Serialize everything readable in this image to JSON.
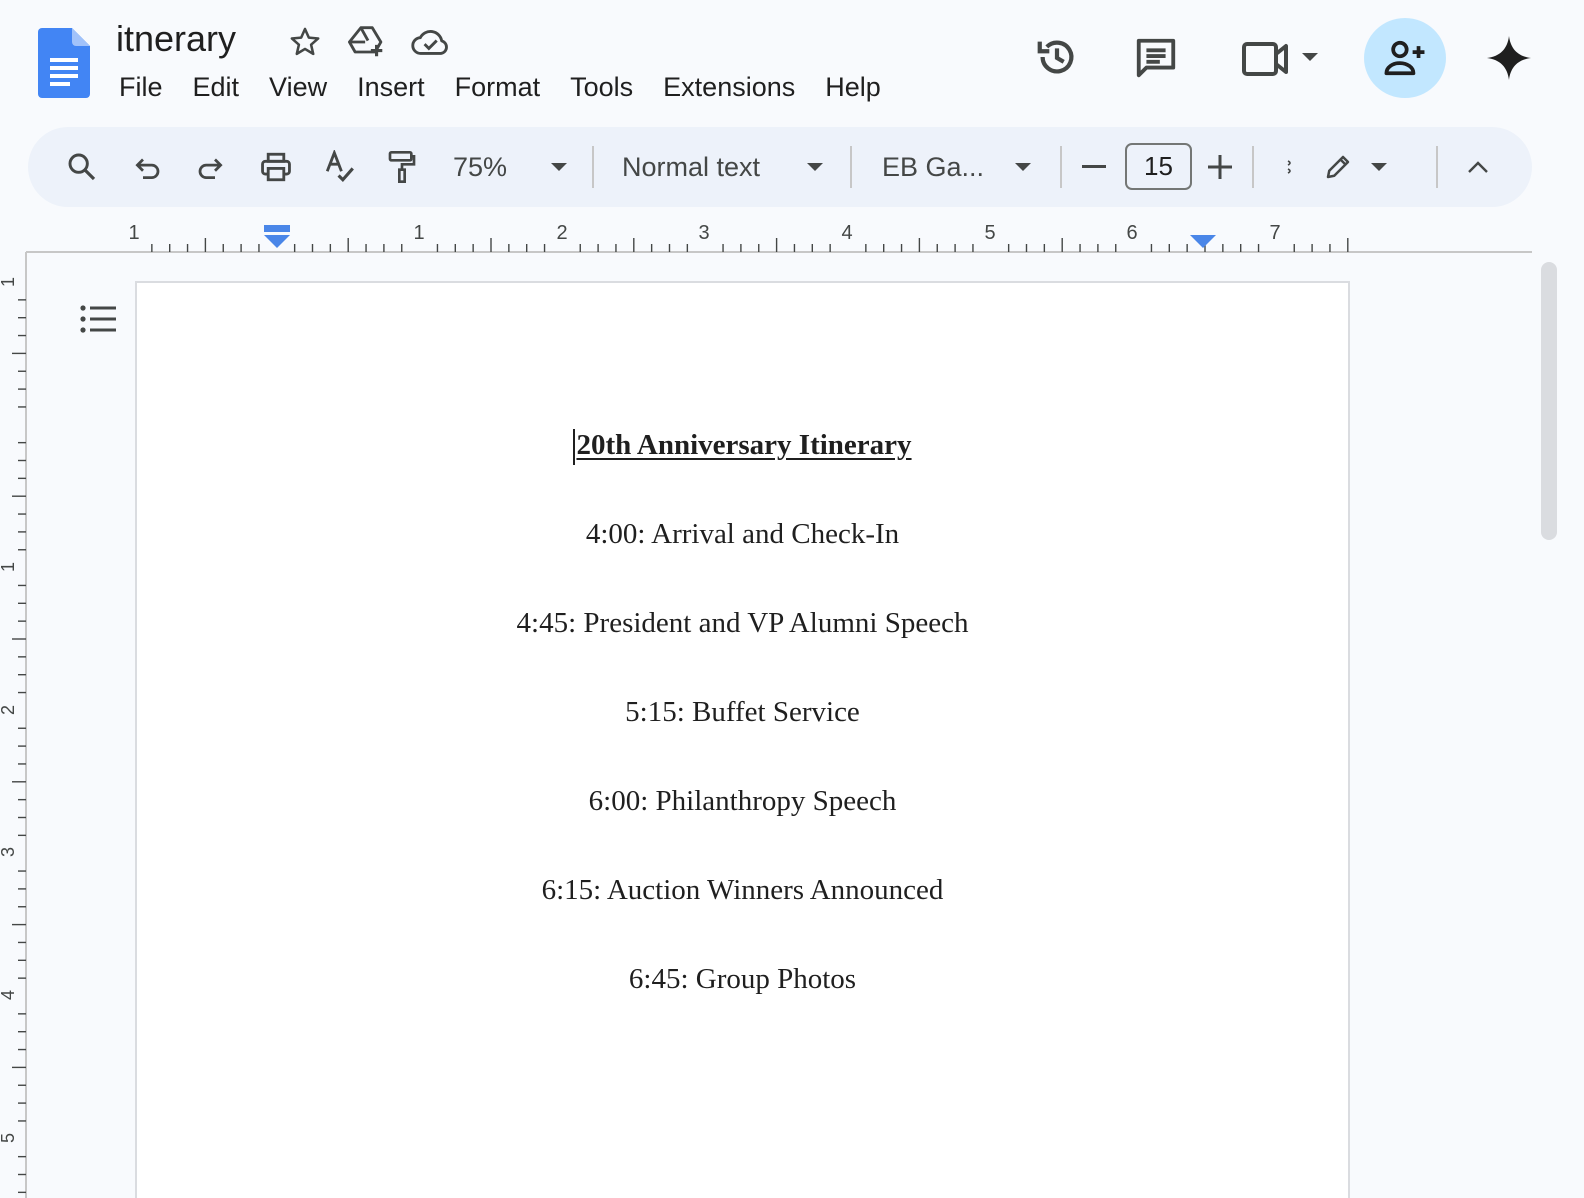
{
  "document": {
    "title": "itnerary"
  },
  "menu": [
    "File",
    "Edit",
    "View",
    "Insert",
    "Format",
    "Tools",
    "Extensions",
    "Help"
  ],
  "toolbar": {
    "zoom": "75%",
    "style": "Normal text",
    "font": "EB Ga...",
    "font_size": "15"
  },
  "ruler": {
    "horizontal_labels": [
      "1",
      "1",
      "2",
      "3",
      "4",
      "5",
      "6",
      "7"
    ],
    "vertical_labels": [
      "1",
      "1",
      "2",
      "3",
      "4",
      "5"
    ]
  },
  "content": {
    "heading": "20th Anniversary Itinerary",
    "items": [
      "4:00: Arrival and Check-In",
      "4:45: President and VP Alumni Speech",
      "5:15: Buffet Service",
      "6:00: Philanthropy Speech",
      "6:15: Auction Winners Announced",
      "6:45: Group Photos"
    ]
  },
  "colors": {
    "docs_blue": "#4285f4",
    "share_bg": "#c2e7ff",
    "toolbar_bg": "#edf2fa",
    "ruler_marker": "#4a86e8"
  },
  "icons": [
    "docs-logo-icon",
    "star-icon",
    "move-to-drive-icon",
    "cloud-saved-icon",
    "history-icon",
    "comments-icon",
    "meet-icon",
    "share-person-add-icon",
    "gemini-sparkle-icon",
    "search-icon",
    "undo-icon",
    "redo-icon",
    "print-icon",
    "spellcheck-icon",
    "paint-format-icon",
    "editing-pencil-icon",
    "collapse-chevron-icon",
    "document-outline-icon"
  ]
}
